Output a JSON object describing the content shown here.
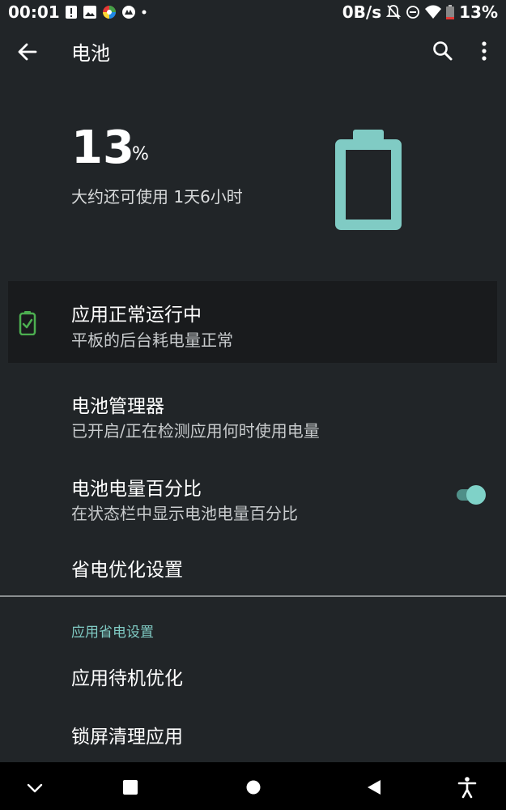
{
  "status_bar": {
    "time": "00:01",
    "net_speed": "0B/s",
    "battery": "13%"
  },
  "app_bar": {
    "title": "电池",
    "icons": [
      "arrow-back-icon",
      "search-icon",
      "more-vert-icon"
    ]
  },
  "battery": {
    "percent": "13",
    "unit": "%",
    "remaining": "大约还可使用 1天6小时",
    "level": 0.13,
    "accent": "#80cbc4"
  },
  "status_card": {
    "title": "应用正常运行中",
    "subtitle": "平板的后台耗电量正常",
    "icon": "battery-ok-icon",
    "icon_color": "#4caf50"
  },
  "settings": [
    {
      "title": "电池管理器",
      "subtitle": "已开启/正在检测应用何时使用电量"
    },
    {
      "title": "电池电量百分比",
      "subtitle": "在状态栏中显示电池电量百分比",
      "toggle_on": true
    },
    {
      "title": "省电优化设置"
    }
  ],
  "section": {
    "label": "应用省电设置",
    "items": [
      {
        "title": "应用待机优化"
      },
      {
        "title": "锁屏清理应用"
      }
    ]
  },
  "nav_bar": {
    "icons": [
      "chevron-down-icon",
      "recents-icon",
      "home-icon",
      "back-icon",
      "accessibility-icon"
    ]
  }
}
